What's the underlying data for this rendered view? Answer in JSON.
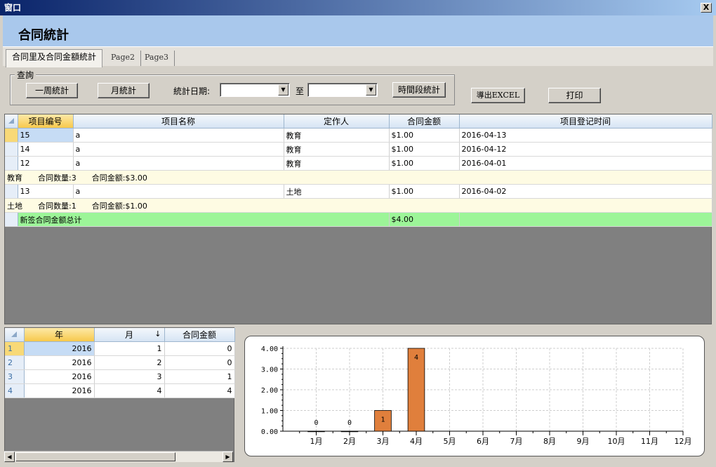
{
  "window": {
    "title": "窗口",
    "close_label": "X"
  },
  "header": {
    "title": "合同統計"
  },
  "tabs": [
    {
      "label": "合同里及合同金額統計"
    },
    {
      "label": "Page2"
    },
    {
      "label": "Page3"
    }
  ],
  "query": {
    "legend": "查詢",
    "week_button": "一周統計",
    "month_button": "月統計",
    "date_label": "統計日期:",
    "to_label": "至",
    "start_date": "",
    "end_date": "",
    "period_button": "時間段統計"
  },
  "toolbar": {
    "export_button": "導出EXCEL",
    "print_button": "打印"
  },
  "main_table": {
    "columns": [
      "项目编号",
      "项目名称",
      "定作人",
      "合同金额",
      "项目登记时间"
    ],
    "rows": [
      {
        "type": "data",
        "id": "15",
        "name": "a",
        "client": "教育",
        "amount": "$1.00",
        "date": "2016-04-13"
      },
      {
        "type": "data",
        "id": "14",
        "name": "a",
        "client": "教育",
        "amount": "$1.00",
        "date": "2016-04-12"
      },
      {
        "type": "data",
        "id": "12",
        "name": "a",
        "client": "教育",
        "amount": "$1.00",
        "date": "2016-04-01"
      },
      {
        "type": "group",
        "text": "教育　　合同数量:3　　合同金额:$3.00"
      },
      {
        "type": "data",
        "id": "13",
        "name": "a",
        "client": "土地",
        "amount": "$1.00",
        "date": "2016-04-02"
      },
      {
        "type": "group",
        "text": "土地　　合同数量:1　　合同金额:$1.00"
      },
      {
        "type": "total",
        "label": "新签合同金额总计",
        "amount": "$4.00"
      }
    ]
  },
  "summary_table": {
    "columns": [
      "年",
      "月",
      "合同金额"
    ],
    "sort_indicator": "↓",
    "rows": [
      {
        "n": "1",
        "year": "2016",
        "month": "1",
        "amount": "0"
      },
      {
        "n": "2",
        "year": "2016",
        "month": "2",
        "amount": "0"
      },
      {
        "n": "3",
        "year": "2016",
        "month": "3",
        "amount": "1"
      },
      {
        "n": "4",
        "year": "2016",
        "month": "4",
        "amount": "4"
      }
    ]
  },
  "chart_data": {
    "type": "bar",
    "categories": [
      "1月",
      "2月",
      "3月",
      "4月",
      "5月",
      "6月",
      "7月",
      "8月",
      "9月",
      "10月",
      "11月",
      "12月"
    ],
    "values": [
      0,
      0,
      1,
      4,
      null,
      null,
      null,
      null,
      null,
      null,
      null,
      null
    ],
    "data_labels": [
      "0",
      "0",
      "1",
      "4"
    ],
    "y_ticks": [
      "0.00",
      "1.00",
      "2.00",
      "3.00",
      "4.00"
    ],
    "ylim": [
      0,
      4
    ],
    "grid": true,
    "bar_color": "#e07f3c"
  }
}
